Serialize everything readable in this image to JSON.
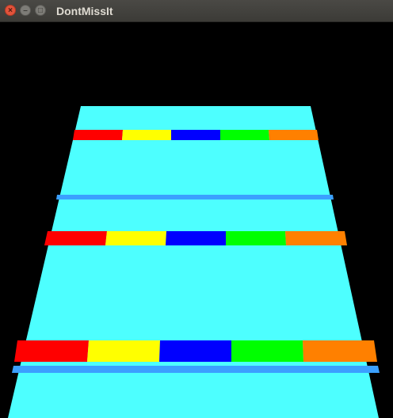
{
  "window": {
    "title": "DontMissIt"
  },
  "controls": {
    "close_icon": "close-icon",
    "minimize_icon": "minimize-icon",
    "maximize_icon": "maximize-icon"
  },
  "colors": {
    "background": "#000000",
    "track": "#4dffff",
    "track_line": "#3ba0ff",
    "segments": [
      "#ff0000",
      "#ffff00",
      "#0000ff",
      "#00ff00",
      "#ff8000"
    ]
  },
  "scene": {
    "segment_rows": 3,
    "segments_per_row": 5,
    "divider_lines": 2
  }
}
